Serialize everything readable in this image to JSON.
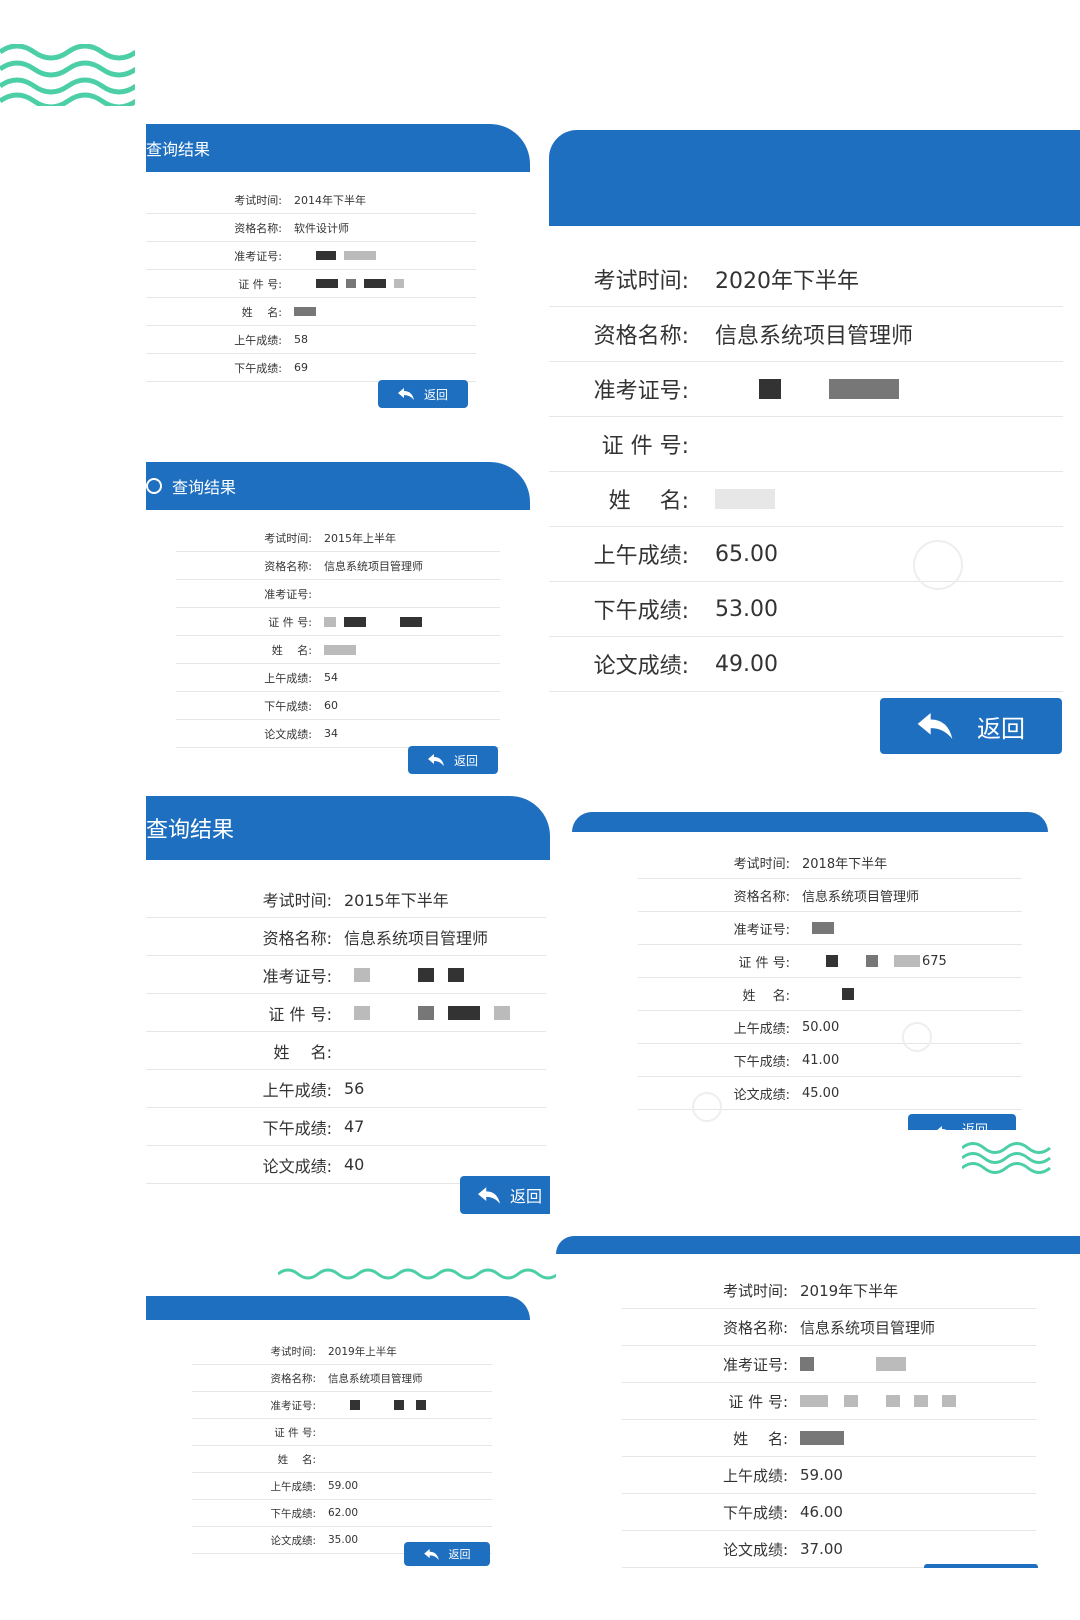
{
  "header_title": "查询结果",
  "back_label": "返回",
  "labels": {
    "exam_time": "考试时间:",
    "qualification": "资格名称:",
    "ticket_no": "准考证号:",
    "id_no": "证 件 号:",
    "name": "姓　 名:",
    "morning": "上午成绩:",
    "afternoon": "下午成绩:",
    "essay": "论文成绩:"
  },
  "cards": [
    {
      "id": "card-2014",
      "exam_time": "2014年下半年",
      "qualification": "软件设计师",
      "ticket_no": "",
      "id_no": "",
      "name": "",
      "morning": "58",
      "afternoon": "69"
    },
    {
      "id": "card-2020",
      "exam_time": "2020年下半年",
      "qualification": "信息系统项目管理师",
      "ticket_no": "",
      "id_no": "",
      "name": "",
      "morning": "65.00",
      "afternoon": "53.00",
      "essay": "49.00"
    },
    {
      "id": "card-2015a",
      "exam_time": "2015年上半年",
      "qualification": "信息系统项目管理师",
      "ticket_no": "",
      "id_no": "",
      "name": "",
      "morning": "54",
      "afternoon": "60",
      "essay": "34"
    },
    {
      "id": "card-2015b",
      "exam_time": "2015年下半年",
      "qualification": "信息系统项目管理师",
      "ticket_no": "",
      "id_no": "",
      "name": "",
      "morning": "56",
      "afternoon": "47",
      "essay": "40"
    },
    {
      "id": "card-2018",
      "exam_time": "2018年下半年",
      "qualification": "信息系统项目管理师",
      "ticket_no": "",
      "id_no": "675",
      "name": "",
      "morning": "50.00",
      "afternoon": "41.00",
      "essay": "45.00"
    },
    {
      "id": "card-2019a",
      "exam_time": "2019年上半年",
      "qualification": "信息系统项目管理师",
      "ticket_no": "",
      "id_no": "",
      "name": "",
      "morning": "59.00",
      "afternoon": "62.00",
      "essay": "35.00"
    },
    {
      "id": "card-2019b",
      "exam_time": "2019年下半年",
      "qualification": "信息系统项目管理师",
      "ticket_no": "",
      "id_no": "",
      "name": "",
      "morning": "59.00",
      "afternoon": "46.00",
      "essay": "37.00"
    }
  ],
  "colors": {
    "header_blue": "#1e6fc0",
    "wave_green": "#4ccfa6"
  },
  "icons": [
    "search-icon",
    "back-arrow-icon",
    "wave-decoration"
  ]
}
